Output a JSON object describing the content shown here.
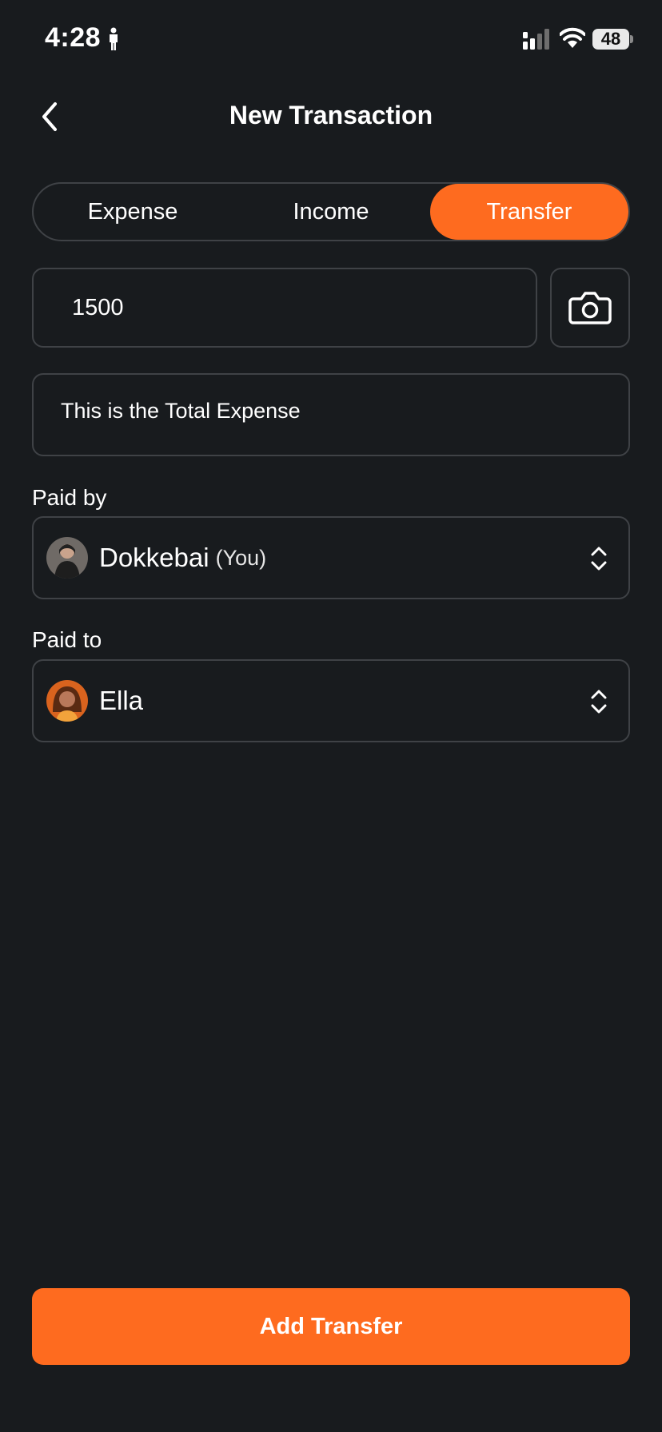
{
  "status_bar": {
    "time": "4:28",
    "battery": "48",
    "icons": [
      "person-icon",
      "signal-icon",
      "wifi-icon",
      "battery-icon"
    ]
  },
  "header": {
    "title": "New Transaction",
    "back_icon": "chevron-left-icon"
  },
  "type_tabs": {
    "items": [
      {
        "label": "Expense",
        "active": false
      },
      {
        "label": "Income",
        "active": false
      },
      {
        "label": "Transfer",
        "active": true
      }
    ]
  },
  "amount": {
    "value": "1500",
    "camera_icon": "camera-icon"
  },
  "description": {
    "value": "This is the Total Expense"
  },
  "paid_by": {
    "label": "Paid by",
    "name": "Dokkebai",
    "suffix": "(You)",
    "icon": "chevron-up-down-icon"
  },
  "paid_to": {
    "label": "Paid to",
    "name": "Ella",
    "icon": "chevron-up-down-icon"
  },
  "submit": {
    "label": "Add Transfer"
  },
  "colors": {
    "background": "#181b1e",
    "accent": "#fe6b1f",
    "border": "#3f4246"
  }
}
